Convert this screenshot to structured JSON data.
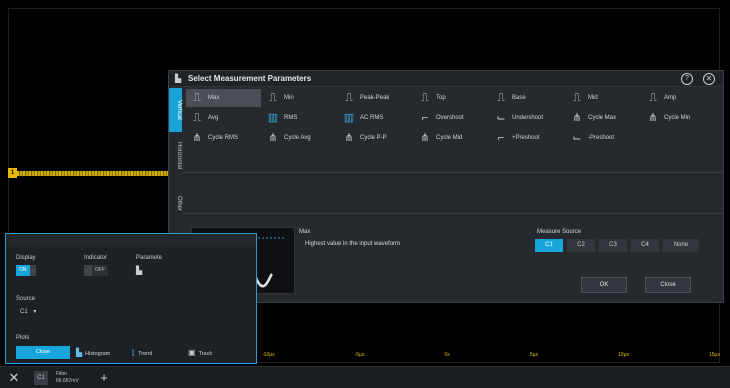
{
  "dialog": {
    "title": "Select Measurement Parameters",
    "help_glyph": "?",
    "close_glyph": "✕",
    "tabs": [
      "Vertical",
      "Horizontal",
      "Other"
    ],
    "params": [
      {
        "label": "Max",
        "icon": "⎍",
        "selected": true
      },
      {
        "label": "Min",
        "icon": "⎍"
      },
      {
        "label": "Peak-Peak",
        "icon": "⎍"
      },
      {
        "label": "Top",
        "icon": "⎍"
      },
      {
        "label": "Base",
        "icon": "⎍"
      },
      {
        "label": "Mid",
        "icon": "⎍"
      },
      {
        "label": "Amp",
        "icon": "⎍"
      },
      {
        "label": "Avg",
        "icon": "⎍"
      },
      {
        "label": "RMS",
        "icon": "▥"
      },
      {
        "label": "AC RMS",
        "icon": "▥"
      },
      {
        "label": "Overshoot",
        "icon": "⌐"
      },
      {
        "label": "Undershoot",
        "icon": "⌙"
      },
      {
        "label": "Cycle Max",
        "icon": "⋔"
      },
      {
        "label": "Cycle Min",
        "icon": "⋔"
      },
      {
        "label": "Cycle RMS",
        "icon": "⋔"
      },
      {
        "label": "Cycle Avg",
        "icon": "⋔"
      },
      {
        "label": "Cycle P-P",
        "icon": "⋔"
      },
      {
        "label": "Cycle Mid",
        "icon": "⋔"
      },
      {
        "label": "+Preshoot",
        "icon": "⌐"
      },
      {
        "label": "-Preshoot",
        "icon": "⌙"
      }
    ],
    "description": {
      "name": "Max",
      "text": "Highest value in the input waveform"
    },
    "measure_source": {
      "label": "Measure Source",
      "options": [
        "C1",
        "C2",
        "C3",
        "C4",
        "None"
      ],
      "selected": "C1"
    },
    "ok_label": "OK",
    "close_label": "Close"
  },
  "panel": {
    "header": "",
    "display_label": "Display",
    "display_on": "ON",
    "display_off": "",
    "indicator_label": "Indicator",
    "indicator_off": "OFF",
    "parameter_label": "Paramete",
    "source_label": "Source",
    "source_value": "C1",
    "source_arrow": "▾",
    "plots_label": "Plots",
    "plot_buttons": [
      "Close",
      "Histogram",
      "Trend",
      "Track"
    ]
  },
  "axis_ticks": [
    "-10μs",
    "-5μs",
    "0s",
    "5μs",
    "10μs",
    "15μs"
  ],
  "bottom_bar": {
    "channel": "C1",
    "text_line1": "Filter",
    "text_line2": "66.667mV"
  },
  "colors": {
    "accent": "#16a6dc",
    "trace": "#d8b600",
    "background": "#000000"
  }
}
